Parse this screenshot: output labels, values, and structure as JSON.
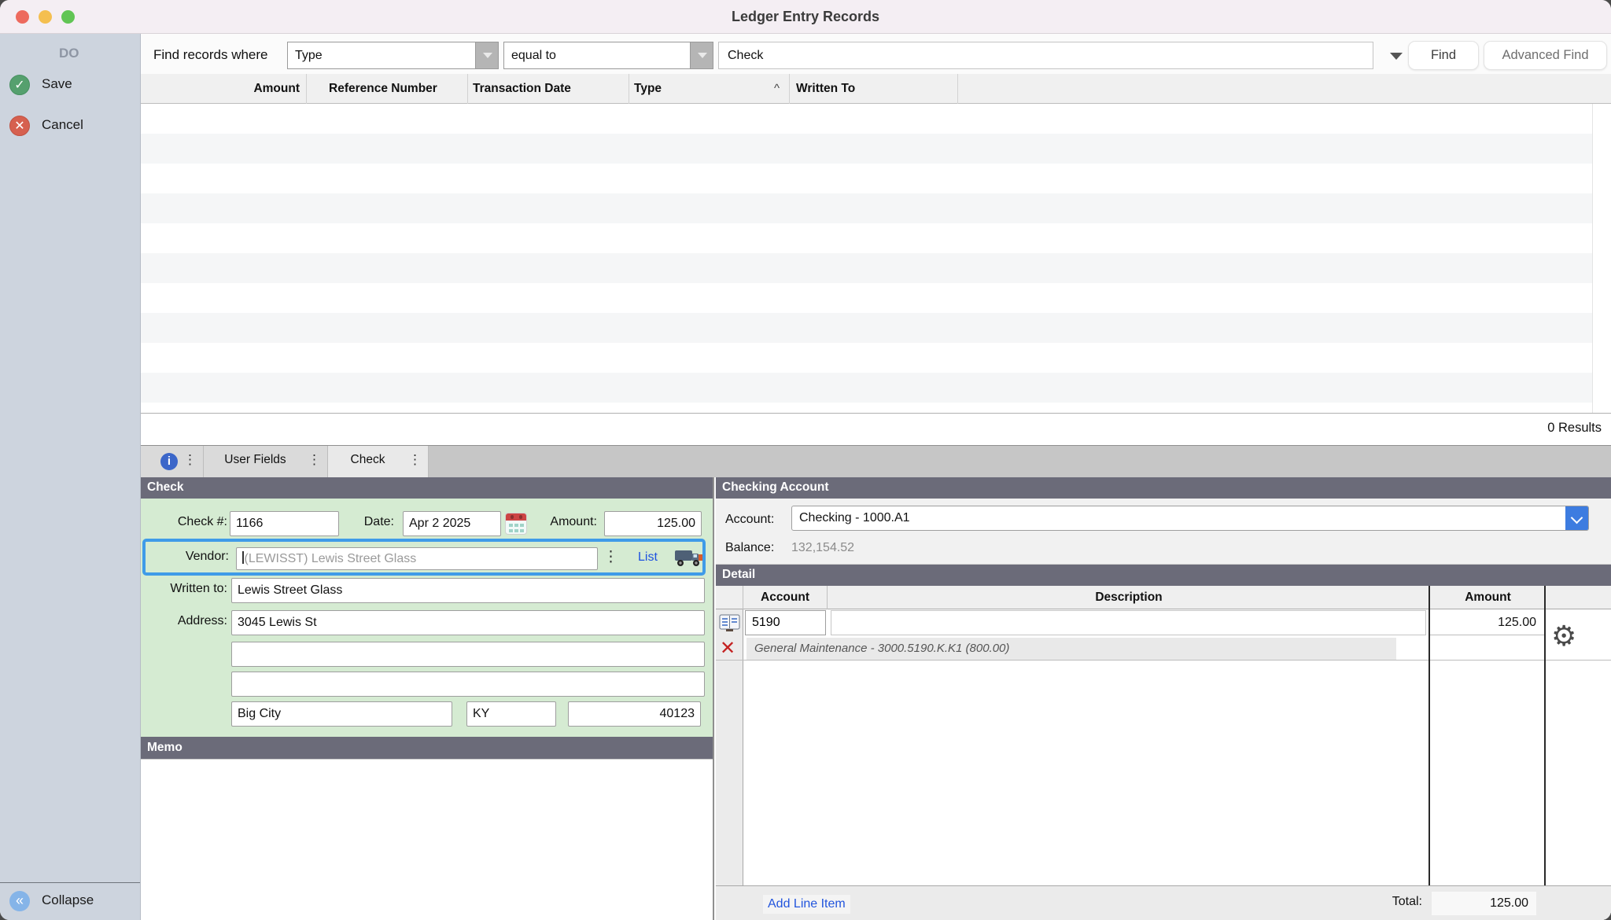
{
  "window": {
    "title": "Ledger Entry Records"
  },
  "sidebar": {
    "group_label": "DO",
    "save_label": "Save",
    "cancel_label": "Cancel",
    "collapse_label": "Collapse"
  },
  "find": {
    "label": "Find records where",
    "field_dropdown": "Type",
    "operator_dropdown": "equal to",
    "value": "Check",
    "find_button": "Find",
    "advanced_button": "Advanced Find"
  },
  "results": {
    "columns": [
      "Amount",
      "Reference Number",
      "Transaction Date",
      "Type",
      "Written To"
    ],
    "sort_column": "Type",
    "sort_indicator": "^",
    "count_text": "0 Results",
    "row_count": 0
  },
  "tabs": {
    "items": [
      "User Fields",
      "Check"
    ],
    "active": "Check"
  },
  "check_form": {
    "header": "Check",
    "check_number_label": "Check #:",
    "check_number": "1166",
    "date_label": "Date:",
    "date": "Apr 2 2025",
    "amount_label": "Amount:",
    "amount": "125.00",
    "vendor_label": "Vendor:",
    "vendor": "(LEWISST) Lewis Street Glass",
    "list_link": "List",
    "written_to_label": "Written to:",
    "written_to": "Lewis Street Glass",
    "address_label": "Address:",
    "address1": "3045 Lewis St",
    "address2": "",
    "address3": "",
    "city": "Big City",
    "state": "KY",
    "zip": "40123",
    "memo_header": "Memo",
    "memo": ""
  },
  "checking_account": {
    "header": "Checking Account",
    "account_label": "Account:",
    "account": "Checking - 1000.A1",
    "balance_label": "Balance:",
    "balance": "132,154.52"
  },
  "detail": {
    "header": "Detail",
    "columns": [
      "Account",
      "Description",
      "Amount"
    ],
    "rows": [
      {
        "account": "5190",
        "description": "",
        "amount": "125.00",
        "note": "General Maintenance - 3000.5190.K.K1 (800.00)"
      }
    ],
    "add_line_item": "Add Line Item",
    "total_label": "Total:",
    "total": "125.00"
  },
  "glyphs": {
    "dots": "⋮",
    "sort_caret": "^",
    "collapse": "«",
    "info": "i",
    "check": "✓",
    "x_mark": "✕",
    "gear": "⚙"
  },
  "colors": {
    "highlight_border": "#3f9be8",
    "section_header": "#6b6b79",
    "form_green": "#d5ebd2",
    "link_blue": "#1d52e0",
    "account_button_blue": "#3d7ce0"
  }
}
